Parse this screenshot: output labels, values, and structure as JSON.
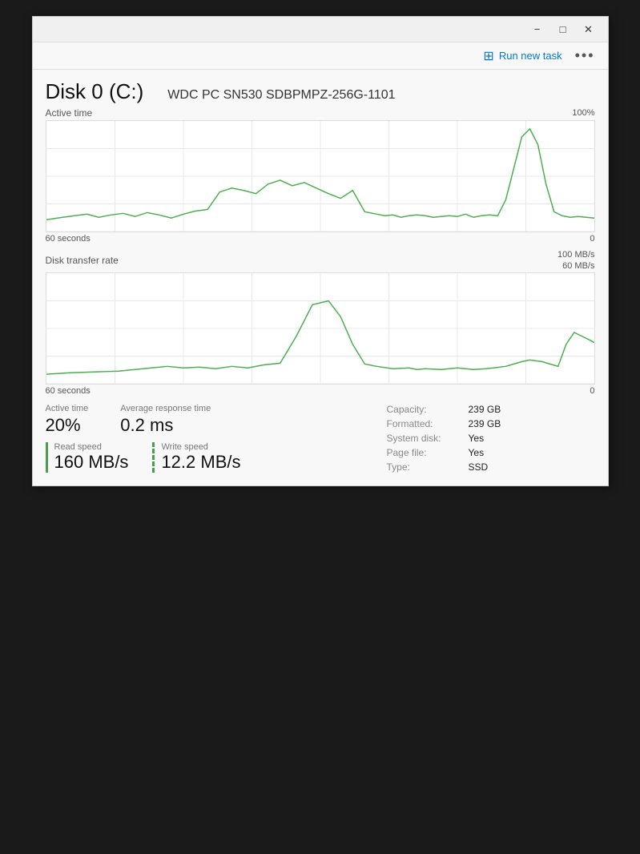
{
  "titlebar": {
    "minimize_label": "−",
    "maximize_label": "□",
    "close_label": "✕"
  },
  "toolbar": {
    "run_new_task_label": "Run new task",
    "more_label": "•••",
    "run_icon": "⊞"
  },
  "disk": {
    "title": "Disk 0 (C:)",
    "model": "WDC PC SN530 SDBPMPZ-256G-1101"
  },
  "active_time_chart": {
    "section_title": "Active time",
    "max_label": "100%",
    "time_label": "60 seconds",
    "zero_label": "0"
  },
  "transfer_rate_chart": {
    "section_title": "Disk transfer rate",
    "max_label_1": "100 MB/s",
    "max_label_2": "60 MB/s",
    "time_label": "60 seconds",
    "zero_label": "0"
  },
  "stats": {
    "active_time_label": "Active time",
    "active_time_value": "20%",
    "avg_response_label": "Average response time",
    "avg_response_value": "0.2 ms",
    "read_speed_label": "Read speed",
    "read_speed_value": "160 MB/s",
    "write_speed_label": "Write speed",
    "write_speed_value": "12.2 MB/s"
  },
  "disk_info": {
    "capacity_label": "Capacity:",
    "capacity_value": "239 GB",
    "formatted_label": "Formatted:",
    "formatted_value": "239 GB",
    "system_disk_label": "System disk:",
    "system_disk_value": "Yes",
    "page_file_label": "Page file:",
    "page_file_value": "Yes",
    "type_label": "Type:",
    "type_value": "SSD"
  }
}
